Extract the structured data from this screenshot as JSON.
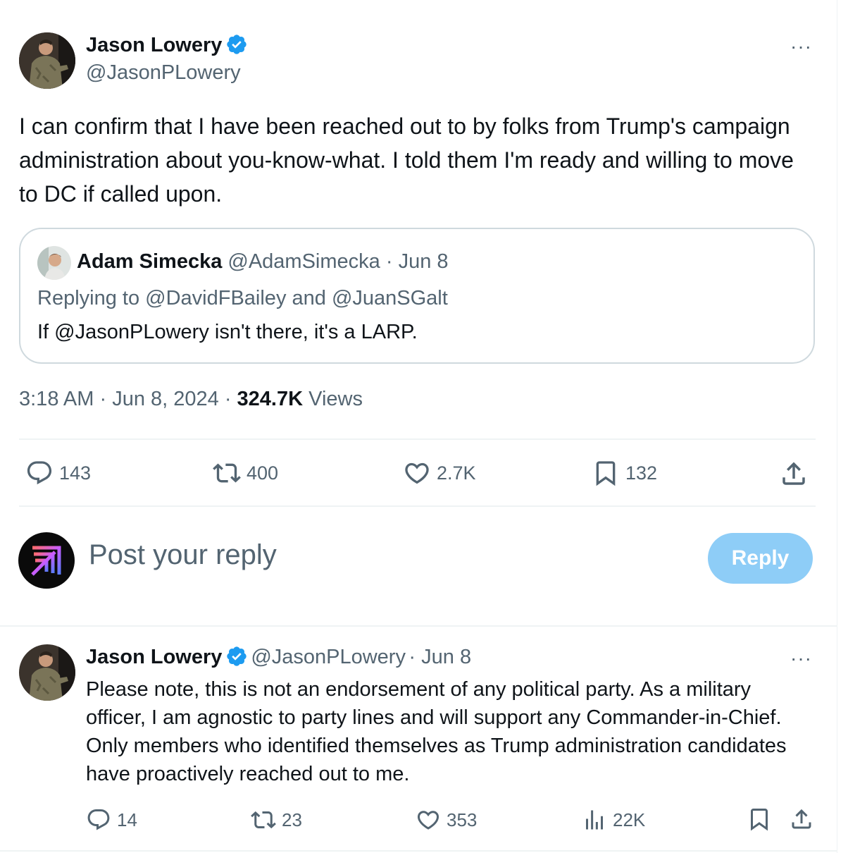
{
  "tweet": {
    "author_name": "Jason Lowery",
    "author_handle": "@JasonPLowery",
    "more_label": "···",
    "text": "I can confirm that I have been reached out to by folks from Trump's campaign administration about you-know-what. I told them I'm ready and willing to move to DC if called upon.",
    "quote": {
      "author_name": "Adam Simecka",
      "author_handle": "@AdamSimecka",
      "date": "· Jun 8",
      "replying_prefix": "Replying to",
      "replying_to_1": "@DavidFBailey",
      "replying_and": "and",
      "replying_to_2": "@JuanSGalt",
      "body": "If @JasonPLowery isn't there, it's a LARP."
    },
    "time": "3:18 AM",
    "date": "Jun 8, 2024",
    "views_count": "324.7K",
    "views_label": "Views",
    "actions": {
      "replies": "143",
      "reposts": "400",
      "likes": "2.7K",
      "bookmarks": "132"
    }
  },
  "composer": {
    "placeholder": "Post your reply",
    "button_label": "Reply"
  },
  "reply": {
    "author_name": "Jason Lowery",
    "author_handle": "@JasonPLowery",
    "date": "· Jun 8",
    "more_label": "···",
    "text": "Please note, this is not an endorsement of any political party. As a military officer, I am agnostic to party lines and will support any Commander-in-Chief. Only members who identified themselves as Trump administration candidates have proactively reached out to me.",
    "actions": {
      "replies": "14",
      "reposts": "23",
      "likes": "353",
      "views": "22K"
    }
  },
  "colors": {
    "verified": "#1d9bf0",
    "secondary_text": "#536471",
    "reply_button": "#8ecdf7",
    "border": "#cfd9de"
  }
}
